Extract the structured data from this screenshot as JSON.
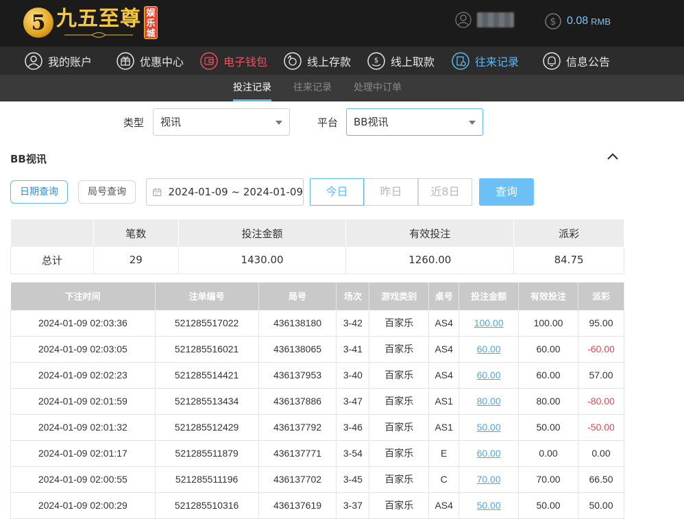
{
  "header": {
    "logo_glyph": "5",
    "brand_name": "九五至尊",
    "brand_tag": "娱乐城",
    "balance_value": "0.08",
    "balance_unit": "RMB"
  },
  "nav": {
    "items": [
      {
        "label": "我的账户",
        "icon": "user-circle-icon"
      },
      {
        "label": "优惠中心",
        "icon": "gift-icon"
      },
      {
        "label": "电子钱包",
        "icon": "wallet-icon"
      },
      {
        "label": "线上存款",
        "icon": "deposit-icon"
      },
      {
        "label": "线上取款",
        "icon": "withdraw-icon"
      },
      {
        "label": "往来记录",
        "icon": "records-icon"
      },
      {
        "label": "信息公告",
        "icon": "bell-icon"
      }
    ]
  },
  "subnav": {
    "tabs": [
      "投注记录",
      "往来记录",
      "处理中订单"
    ]
  },
  "filters": {
    "type_label": "类型",
    "type_value": "视讯",
    "platform_label": "平台",
    "platform_value": "BB视讯"
  },
  "section": {
    "title": "BB视讯"
  },
  "query": {
    "mode_date": "日期查询",
    "mode_round": "局号查询",
    "date_range": "2024-01-09 ~ 2024-01-09",
    "quick": [
      "今日",
      "昨日",
      "近8日"
    ],
    "submit": "查询"
  },
  "summary": {
    "headers": [
      "",
      "笔数",
      "投注金额",
      "有效投注",
      "派彩"
    ],
    "row": [
      "总计",
      "29",
      "1430.00",
      "1260.00",
      "84.75"
    ]
  },
  "records": {
    "headers": [
      "下注时间",
      "注单编号",
      "局号",
      "场次",
      "游戏类别",
      "桌号",
      "投注金额",
      "有效投注",
      "派彩"
    ],
    "rows": [
      [
        "2024-01-09 02:03:36",
        "521285517022",
        "436138180",
        "3-42",
        "百家乐",
        "AS4",
        "100.00",
        "100.00",
        "95.00"
      ],
      [
        "2024-01-09 02:03:05",
        "521285516021",
        "436138065",
        "3-41",
        "百家乐",
        "AS4",
        "60.00",
        "60.00",
        "-60.00"
      ],
      [
        "2024-01-09 02:02:23",
        "521285514421",
        "436137953",
        "3-40",
        "百家乐",
        "AS4",
        "60.00",
        "60.00",
        "57.00"
      ],
      [
        "2024-01-09 02:01:59",
        "521285513434",
        "436137886",
        "3-47",
        "百家乐",
        "AS1",
        "80.00",
        "80.00",
        "-80.00"
      ],
      [
        "2024-01-09 02:01:32",
        "521285512429",
        "436137792",
        "3-46",
        "百家乐",
        "AS1",
        "50.00",
        "50.00",
        "-50.00"
      ],
      [
        "2024-01-09 02:01:17",
        "521285511879",
        "436137771",
        "3-54",
        "百家乐",
        "E",
        "60.00",
        "0.00",
        "0.00"
      ],
      [
        "2024-01-09 02:00:55",
        "521285511196",
        "436137702",
        "3-45",
        "百家乐",
        "C",
        "70.00",
        "70.00",
        "66.50"
      ],
      [
        "2024-01-09 02:00:29",
        "521285510316",
        "436137619",
        "3-37",
        "百家乐",
        "AS4",
        "50.00",
        "50.00",
        "50.00"
      ]
    ]
  },
  "colors": {
    "accent_blue": "#5fb8f3",
    "accent_red": "#ef4f5c",
    "negative": "#e2464f"
  }
}
